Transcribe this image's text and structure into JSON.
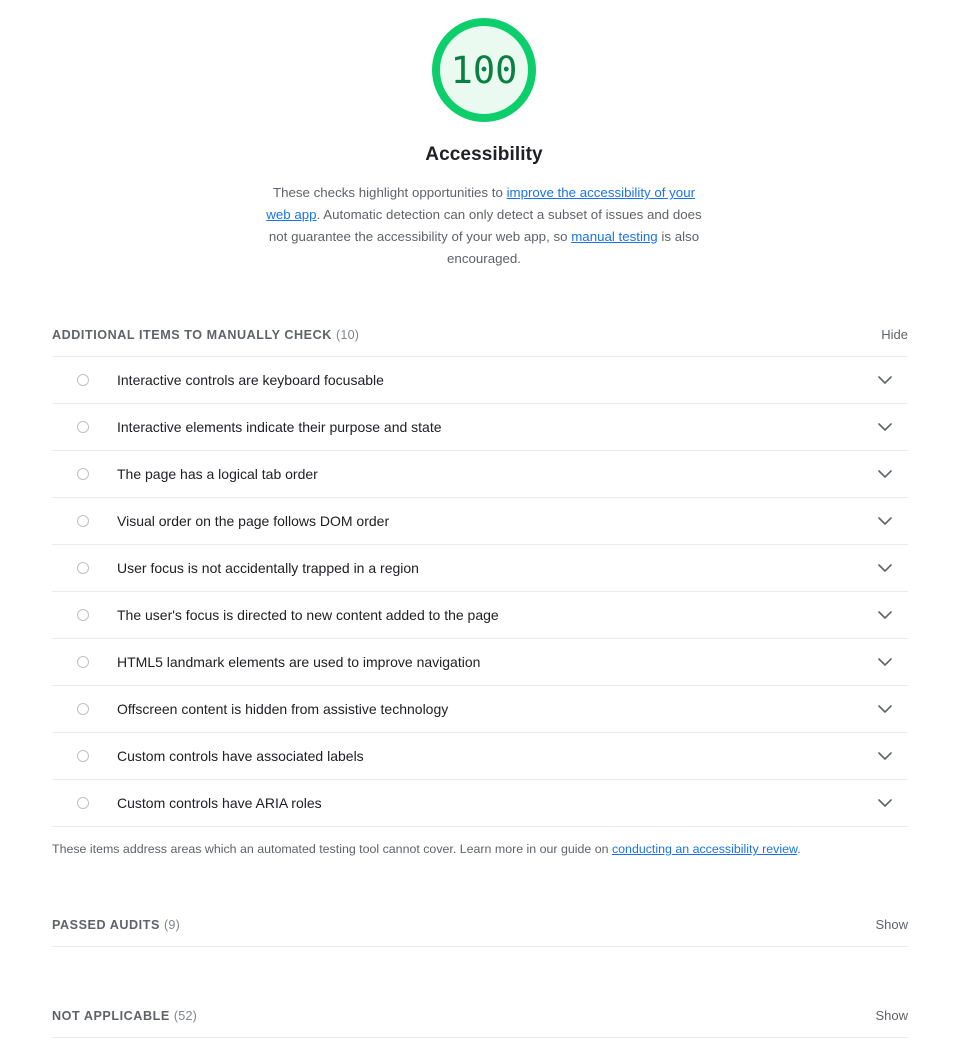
{
  "gauge": {
    "score": "100",
    "title": "Accessibility",
    "ring_color": "#0cce6b",
    "fill_color": "#eafaf1",
    "score_color": "#0b8043",
    "description": {
      "part1": "These checks highlight opportunities to ",
      "link1": "improve the accessibility of your web app",
      "part2": ". Automatic detection can only detect a subset of issues and does not guarantee the accessibility of your web app, so ",
      "link2": "manual testing",
      "part3": " is also encouraged."
    }
  },
  "manual_section": {
    "heading": "ADDITIONAL ITEMS TO MANUALLY CHECK",
    "count": "(10)",
    "toggle": "Hide",
    "items": [
      {
        "title": "Interactive controls are keyboard focusable",
        "icon": "circle-icon",
        "chevron": "chevron-down-icon"
      },
      {
        "title": "Interactive elements indicate their purpose and state",
        "icon": "circle-icon",
        "chevron": "chevron-down-icon"
      },
      {
        "title": "The page has a logical tab order",
        "icon": "circle-icon",
        "chevron": "chevron-down-icon"
      },
      {
        "title": "Visual order on the page follows DOM order",
        "icon": "circle-icon",
        "chevron": "chevron-down-icon"
      },
      {
        "title": "User focus is not accidentally trapped in a region",
        "icon": "circle-icon",
        "chevron": "chevron-down-icon"
      },
      {
        "title": "The user's focus is directed to new content added to the page",
        "icon": "circle-icon",
        "chevron": "chevron-down-icon"
      },
      {
        "title": "HTML5 landmark elements are used to improve navigation",
        "icon": "circle-icon",
        "chevron": "chevron-down-icon"
      },
      {
        "title": "Offscreen content is hidden from assistive technology",
        "icon": "circle-icon",
        "chevron": "chevron-down-icon"
      },
      {
        "title": "Custom controls have associated labels",
        "icon": "circle-icon",
        "chevron": "chevron-down-icon"
      },
      {
        "title": "Custom controls have ARIA roles",
        "icon": "circle-icon",
        "chevron": "chevron-down-icon"
      }
    ],
    "note": {
      "part1": "These items address areas which an automated testing tool cannot cover. Learn more in our guide on ",
      "link": "conducting an accessibility review",
      "part2": "."
    }
  },
  "passed_section": {
    "heading": "PASSED AUDITS",
    "count": "(9)",
    "toggle": "Show"
  },
  "not_applicable_section": {
    "heading": "NOT APPLICABLE",
    "count": "(52)",
    "toggle": "Show"
  },
  "colors": {
    "link": "#1a73e8",
    "muted_text": "#5f6368",
    "border": "#ebebeb",
    "body_text": "#202124"
  }
}
